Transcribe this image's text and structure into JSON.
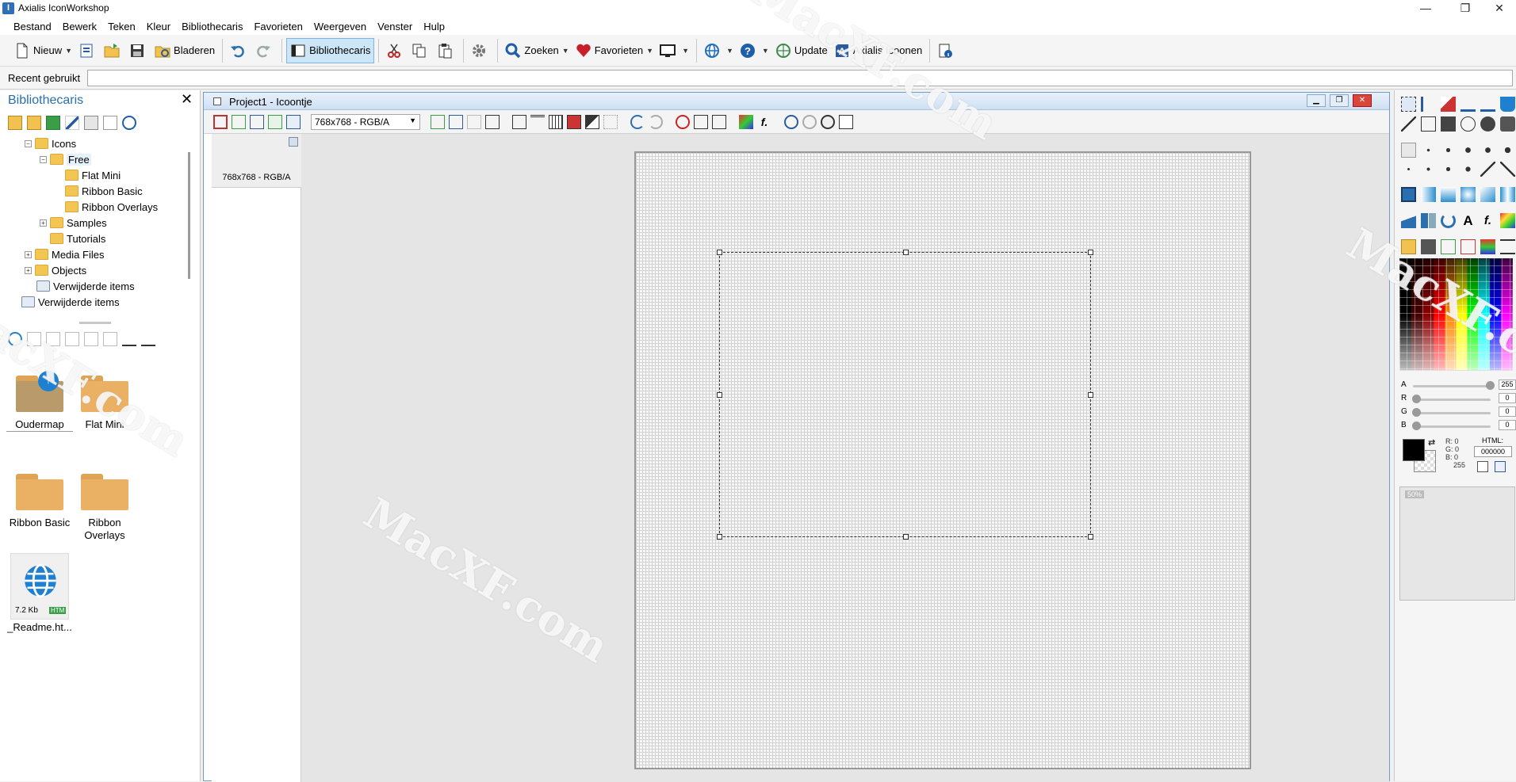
{
  "window": {
    "title": "Axialis IconWorkshop",
    "app_icon_letter": "I",
    "minimize": "—",
    "maximize": "❐",
    "close": "✕"
  },
  "menu": [
    "Bestand",
    "Bewerk",
    "Teken",
    "Kleur",
    "Bibliothecaris",
    "Favorieten",
    "Weergeven",
    "Venster",
    "Hulp"
  ],
  "toolbar": {
    "new_label": "Nieuw",
    "browse_label": "Bladeren",
    "librarian_label": "Bibliothecaris",
    "search_label": "Zoeken",
    "favorites_label": "Favorieten",
    "update_label": "Update",
    "axialis_icons_label": "Axialis Icoonen"
  },
  "recent": {
    "label": "Recent gebruikt",
    "value": ""
  },
  "librarian": {
    "title": "Bibliothecaris",
    "close": "✕",
    "tree": [
      {
        "label": "Icons",
        "indent": 1
      },
      {
        "label": "Free",
        "indent": 2
      },
      {
        "label": "Flat Mini",
        "indent": 3
      },
      {
        "label": "Ribbon Basic",
        "indent": 3
      },
      {
        "label": "Ribbon Overlays",
        "indent": 3
      },
      {
        "label": "Samples",
        "indent": 2
      },
      {
        "label": "Tutorials",
        "indent": 2
      },
      {
        "label": "Media Files",
        "indent": 1
      },
      {
        "label": "Objects",
        "indent": 1
      },
      {
        "label": "Verwijderde items",
        "indent": 1
      },
      {
        "label": "Verwijderde items",
        "indent": 0
      }
    ],
    "tiles": [
      {
        "label": "Oudermap"
      },
      {
        "label": "Flat Mini"
      },
      {
        "label": "Ribbon Basic"
      },
      {
        "label": "Ribbon Overlays"
      },
      {
        "label": "_Readme.ht...",
        "size": "7.2 Kb",
        "badge": "HTM"
      }
    ]
  },
  "document": {
    "title": "Project1 - Icoontje",
    "format": "768x768 - RGB/A",
    "thumb_label": "768x768 - RGB/A"
  },
  "color": {
    "a": "255",
    "r": "0",
    "g": "0",
    "b": "0",
    "a_label": "A",
    "r_label": "R",
    "g_label": "G",
    "b_label": "B",
    "rgb_r": "R:  0",
    "rgb_g": "G:  0",
    "rgb_b": "B:  0",
    "rgb_a": "255",
    "html_label": "HTML:",
    "html_value": "000000",
    "foreground": "#000000",
    "accent": "#2a6fb0"
  },
  "preview": {
    "zoom": "50%"
  },
  "watermark": "MacXF.com"
}
